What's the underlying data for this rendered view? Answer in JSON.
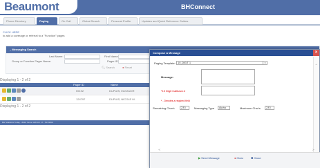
{
  "header": {
    "logo_text": "Beaumont",
    "app_title": "BHConnect"
  },
  "tabs": [
    {
      "label": "Phone Directory"
    },
    {
      "label": "Paging"
    },
    {
      "label": "On Call"
    },
    {
      "label": "Global Search"
    },
    {
      "label": "Personal Profile"
    },
    {
      "label": "Updates and Quick Reference Guides"
    }
  ],
  "page": {
    "click_here": "CLICK HERE",
    "instruction": "to add a coverage or referral to a \"Function\" pages"
  },
  "messaging_search": {
    "title": "Messaging Search",
    "last_name_label": "Last Name:",
    "first_name_label": "First Name:",
    "group_label": "Group or Function Pager Name:",
    "pager_id_label": "Pager ID:",
    "search_label": "Search",
    "reset_label": "Reset"
  },
  "results": {
    "displaying_top": "Displaying 1 - 2 of 2",
    "displaying_bottom": "Displaying 1 - 2 of 2",
    "column_pager_id": "Pager ID",
    "column_name": "Name",
    "rows": [
      {
        "pager_id": "59192",
        "name": "DUPUIS, ELEANOR"
      },
      {
        "pager_id": "124797",
        "name": "DUPUIS, NICOLE M."
      }
    ]
  },
  "status_bar": {
    "text": "BH Statistics Today - 8046 Since 10/NOV 17 - 5174699"
  },
  "modal": {
    "title": "Compose A Message",
    "close_label": "×",
    "paging_template_label": "Paging Template:",
    "paging_template_value": "10_DIGIT 1",
    "message_label": "Message:",
    "callback_label": "*10 Digit Callback #",
    "required_note": "* - Denotes a required field",
    "remaining_chars_label": "Remaining Char's",
    "remaining_chars_value": "233",
    "messaging_type_label": "Messaging Type",
    "messaging_type_value": "Alpha",
    "max_chars_label": "Maximum Char's",
    "max_chars_value": "233",
    "send_label": "Send Message",
    "clear_label": "Clear",
    "close_btn_label": "Close"
  },
  "colors": {
    "brand_blue": "#2a4f94",
    "required_red": "#dd0000",
    "send_green": "#3a9a3a"
  }
}
